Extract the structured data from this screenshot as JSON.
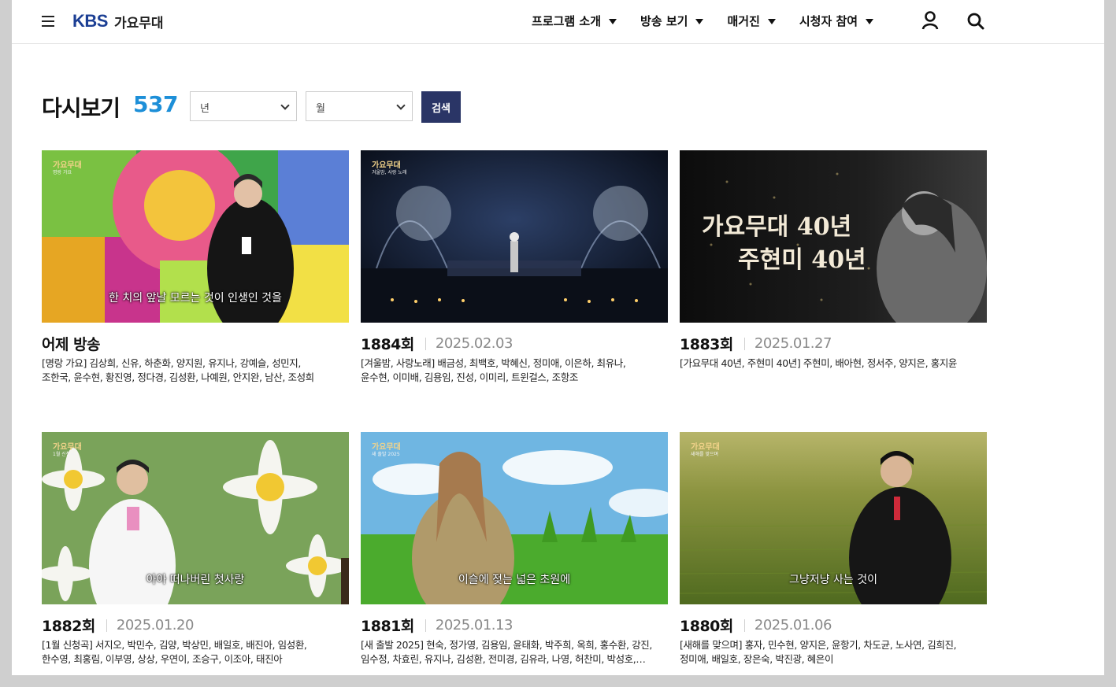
{
  "header": {
    "brand": "KBS",
    "program": "가요무대",
    "nav": [
      "프로그램 소개",
      "방송 보기",
      "매거진",
      "시청자 참여"
    ],
    "icons": [
      "menu-icon",
      "user-icon",
      "search-icon"
    ]
  },
  "page": {
    "title": "다시보기",
    "count": "537",
    "year_select": "년",
    "month_select": "월",
    "search_button": "검색"
  },
  "colors": {
    "brand_blue": "#1c3f94",
    "count_blue": "#1d8fd8",
    "button_navy": "#2a3566"
  },
  "episodes": [
    {
      "episode": "어제 방송",
      "date": "",
      "caption": "한 치의 앞날 모르는 것이 인생인 것을",
      "desc_line1": "[명랑 가요] 김상희, 신유, 하춘화, 양지원, 유지나, 강예슬, 성민지,",
      "desc_line2": "조한국, 윤수현, 황진영, 정다경, 김성환, 나예원, 안지완, 남산, 조성희"
    },
    {
      "episode": "1884회",
      "date": "2025.02.03",
      "caption": "",
      "desc_line1": "[겨울밤, 사랑노래] 배금성, 최백호, 박혜신, 정미애, 이은하, 최유나,",
      "desc_line2": "윤수현, 이미배, 김용임, 진성, 이미리, 트윈걸스, 조항조"
    },
    {
      "episode": "1883회",
      "date": "2025.01.27",
      "caption": "",
      "desc_line1": "[가요무대 40년, 주현미 40년] 주현미, 배아현, 정서주, 양지은, 홍지윤",
      "desc_line2": ""
    },
    {
      "episode": "1882회",
      "date": "2025.01.20",
      "caption": "아아 떠나버린 첫사랑",
      "desc_line1": "[1월 신청곡] 서지오, 박민수, 김양, 박상민, 배일호, 배진아, 임성환,",
      "desc_line2": "한수영, 최홍림, 이부영, 상상, 우연이, 조승구, 이조아, 태진아"
    },
    {
      "episode": "1881회",
      "date": "2025.01.13",
      "caption": "이슬에 젖는 넓은 초원에",
      "desc_line1": "[새 출발 2025] 현숙, 정가영, 김용임, 윤태화, 박주희, 옥희, 홍수환, 강진,",
      "desc_line2": "임수정, 차효린, 유지나, 김성환, 전미경, 김유라, 나영, 허찬미, 박성호,…"
    },
    {
      "episode": "1880회",
      "date": "2025.01.06",
      "caption": "그냥저냥 사는 것이",
      "desc_line1": "[새해를 맞으며] 홍자, 민수현, 양지은, 윤항기, 차도균, 노사연, 김희진,",
      "desc_line2": "정미애, 배일호, 장은숙, 박진광, 혜은이"
    }
  ],
  "thumb_overlays": {
    "logo": "가요무대",
    "ep2_sub": "겨울밤, 사랑 노래",
    "ep3_big1": "가요무대 40년",
    "ep3_big2": "주현미 40년",
    "ep1_sub": "명랑 가요",
    "ep4_sub": "1월 신청곡",
    "ep5_sub": "새 출발 2025",
    "ep6_sub": "새해를 맞으며"
  }
}
